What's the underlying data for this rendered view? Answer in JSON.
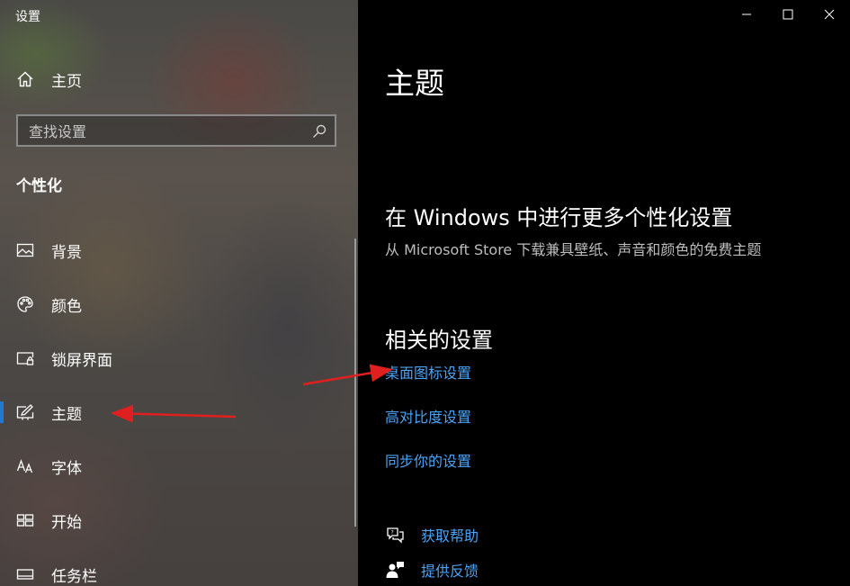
{
  "window": {
    "title": "设置",
    "controls": [
      "minimize-icon",
      "maximize-icon",
      "close-icon"
    ]
  },
  "sidebar": {
    "home_label": "主页",
    "search": {
      "placeholder": "查找设置",
      "value": ""
    },
    "section_title": "个性化",
    "items": [
      {
        "label": "背景",
        "icon": "picture-icon"
      },
      {
        "label": "颜色",
        "icon": "palette-icon"
      },
      {
        "label": "锁屏界面",
        "icon": "lockscreen-icon"
      },
      {
        "label": "主题",
        "icon": "theme-brush-icon",
        "active": true
      },
      {
        "label": "字体",
        "icon": "font-icon"
      },
      {
        "label": "开始",
        "icon": "start-icon"
      },
      {
        "label": "任务栏",
        "icon": "taskbar-icon"
      }
    ]
  },
  "main": {
    "title": "主题",
    "promo": {
      "heading": "在 Windows 中进行更多个性化设置",
      "text": "从 Microsoft Store 下载兼具壁纸、声音和颜色的免费主题"
    },
    "related": {
      "heading": "相关的设置",
      "links": [
        "桌面图标设置",
        "高对比度设置",
        "同步你的设置"
      ]
    },
    "help": [
      {
        "label": "获取帮助",
        "icon": "help-chat-icon"
      },
      {
        "label": "提供反馈",
        "icon": "feedback-icon"
      }
    ]
  },
  "colors": {
    "accent": "#1f7ad1",
    "link": "#4ba3f5",
    "annotation_arrow": "#e02020"
  }
}
